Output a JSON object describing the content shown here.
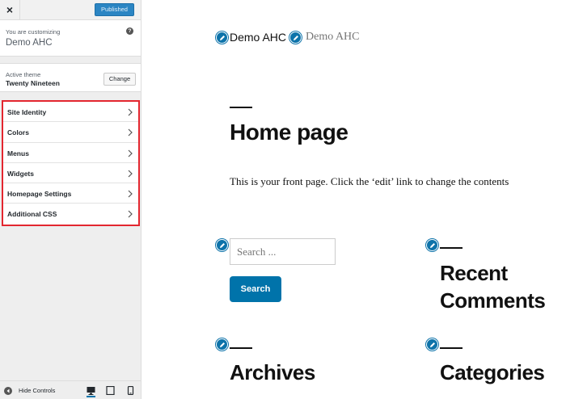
{
  "sidebar": {
    "close_glyph": "×",
    "publish_label": "Published",
    "customizing_label": "You are customizing",
    "site_name": "Demo AHC",
    "help_glyph": "?",
    "active_theme_label": "Active theme",
    "theme_name": "Twenty Nineteen",
    "change_label": "Change",
    "menu_items": [
      {
        "label": "Site Identity"
      },
      {
        "label": "Colors"
      },
      {
        "label": "Menus"
      },
      {
        "label": "Widgets"
      },
      {
        "label": "Homepage Settings"
      },
      {
        "label": "Additional CSS"
      }
    ],
    "hide_controls_label": "Hide Controls",
    "devices": [
      "desktop-icon",
      "tablet-icon",
      "mobile-icon"
    ]
  },
  "preview": {
    "site_title": "Demo AHC",
    "site_description": "Demo AHC",
    "page_title": "Home page",
    "page_text": "This is your front page. Click the ‘edit’ link to change the contents",
    "search_placeholder": "Search ...",
    "search_button": "Search",
    "widgets": {
      "recent_comments": "Recent Comments",
      "archives": "Archives",
      "categories": "Categories"
    }
  },
  "colors": {
    "accent": "#0073aa",
    "highlight_border": "#e3262f",
    "publish_button": "#2b85c3"
  }
}
